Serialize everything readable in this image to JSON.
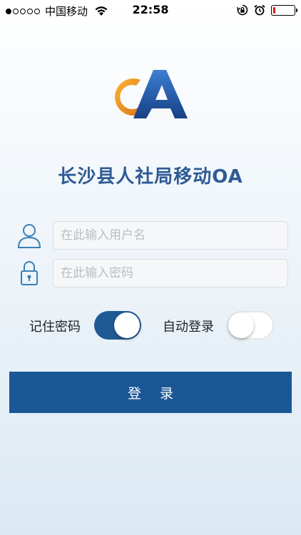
{
  "status_bar": {
    "carrier": "中国移动",
    "time": "22:58",
    "battery_level": 0.12,
    "icons": [
      "signal-dots-icon",
      "wifi-icon",
      "rotation-lock-icon",
      "alarm-icon",
      "battery-icon"
    ]
  },
  "app": {
    "title": "长沙县人社局移动OA",
    "logo_text": "OA"
  },
  "form": {
    "username": {
      "placeholder": "在此输入用户名",
      "value": "",
      "icon": "user-icon"
    },
    "password": {
      "placeholder": "在此输入密码",
      "value": "",
      "icon": "lock-icon"
    },
    "remember_password": {
      "label": "记住密码",
      "enabled": true
    },
    "auto_login": {
      "label": "自动登录",
      "enabled": false
    },
    "login_label": "登录"
  },
  "colors": {
    "accent": "#1b5796",
    "title": "#2f5b94",
    "logo_orange": "#f0a020",
    "logo_blue": "#1f56a5"
  }
}
